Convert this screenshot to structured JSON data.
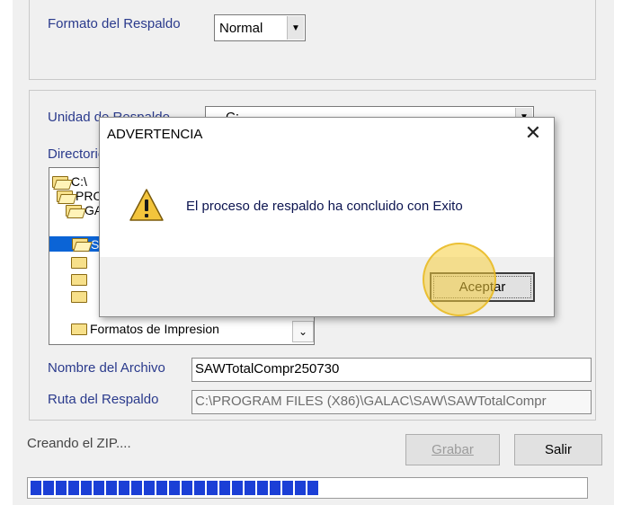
{
  "backup_form": {
    "format_label": "Formato del Respaldo",
    "format_value": "Normal",
    "unit_label": "Unidad de Respaldo",
    "unit_value": "C:",
    "directory_label": "Directorio",
    "folders": [
      {
        "name": "C:\\",
        "open": true
      },
      {
        "name": "PROGRAM FILES (X86)",
        "open": true
      },
      {
        "name": "GALAC",
        "open": true
      },
      {
        "name": "SAW",
        "open": true,
        "selected": true
      },
      {
        "name": "",
        "open": false
      },
      {
        "name": "",
        "open": false
      },
      {
        "name": "",
        "open": false
      },
      {
        "name": "Formatos de Impresion",
        "open": false
      }
    ],
    "filename_label": "Nombre del Archivo",
    "filename_value": "SAWTotalCompr250730",
    "path_label": "Ruta del Respaldo",
    "path_value": "C:\\PROGRAM FILES (X86)\\GALAC\\SAW\\SAWTotalCompr",
    "status_text": "Creando el ZIP....",
    "save_button": "Grabar",
    "exit_button": "Salir",
    "progress": 0.52,
    "colors": {
      "progress": "#1b3fd6",
      "selection": "#0b64d6"
    }
  },
  "dialog": {
    "title": "ADVERTENCIA",
    "message": "El proceso de respaldo ha concluido con Exito",
    "ok_label": "Aceptar",
    "icon": "warning-icon"
  }
}
